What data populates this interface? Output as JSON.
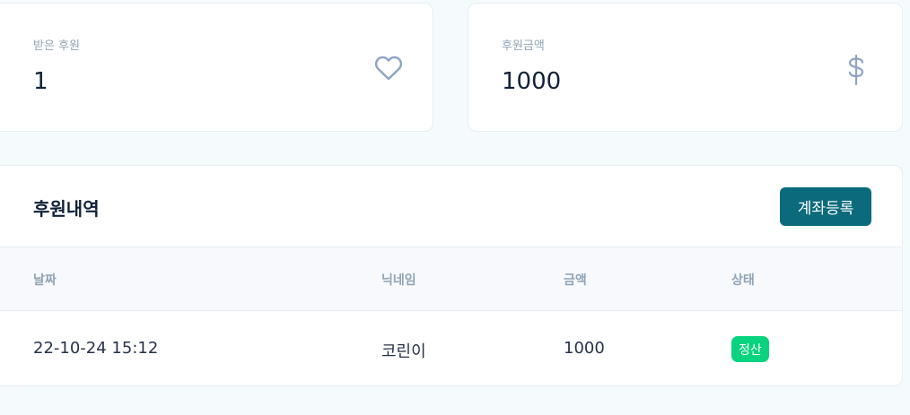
{
  "stats": {
    "received": {
      "label": "받은 후원",
      "value": "1",
      "icon": "heart-icon"
    },
    "amount": {
      "label": "후원금액",
      "value": "1000",
      "icon": "dollar-icon"
    }
  },
  "history": {
    "title": "후원내역",
    "register_button": "계좌등록",
    "columns": [
      "날짜",
      "닉네임",
      "금액",
      "상태"
    ],
    "rows": [
      {
        "date": "22-10-24 15:12",
        "nickname": "코린이",
        "amount": "1000",
        "status": "정산"
      }
    ]
  },
  "colors": {
    "accent": "#0b6b7c",
    "status_settled": "#08d37f",
    "icon": "#8fa3c4"
  }
}
